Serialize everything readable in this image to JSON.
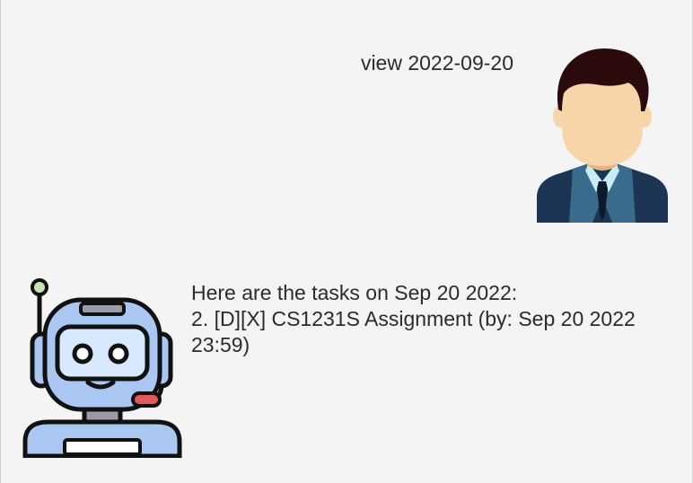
{
  "conversation": {
    "user_message": {
      "text": "view 2022-09-20",
      "avatar_icon": "user-avatar-icon"
    },
    "bot_message": {
      "text": "Here are the tasks on Sep 20 2022:\n2. [D][X] CS1231S Assignment (by: Sep 20 2022\n23:59)",
      "avatar_icon": "robot-avatar-icon"
    }
  },
  "colors": {
    "background": "#f4f4f4",
    "text": "#2b2b2b",
    "suit": "#1c3554",
    "skin": "#f8d5a8",
    "hair": "#2a0a0a",
    "robot_body": "#a9c7f0",
    "robot_outline": "#111111",
    "robot_accent": "#e25a5a"
  }
}
